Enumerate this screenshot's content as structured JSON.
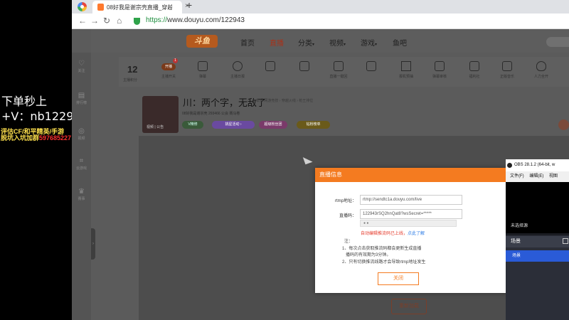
{
  "overlay": {
    "line1": "下单秒上",
    "line2": "+V：nb122943",
    "line3": "评估CF/和平精英/手游",
    "line4_text": "脱坑入坑加群",
    "line4_num": "597685227"
  },
  "browser": {
    "tab_title": "08好我是谢宗壳直播_穿越火线",
    "url_scheme": "https://",
    "url_rest": "www.douyu.com/122943"
  },
  "leftnav": {
    "items": [
      {
        "icon": "♡",
        "label": "关注"
      },
      {
        "icon": "▤",
        "label": "排行榜"
      },
      {
        "icon": "◎",
        "label": "视频"
      },
      {
        "icon": "⌗",
        "label": "云游戏"
      },
      {
        "icon": "♛",
        "label": "赛事"
      }
    ]
  },
  "header": {
    "logo": "斗鱼",
    "nav": [
      "首页",
      "直播",
      "分类",
      "视频",
      "游戏",
      "鱼吧"
    ]
  },
  "gifts": {
    "count": "12",
    "count_label": "主播积分",
    "kaibo": "开播",
    "badge": "1",
    "items": [
      "主播开关",
      "弹幕",
      "主播日报",
      "",
      "",
      "直播一键回",
      "",
      "报机预抽",
      "弹幕审核",
      "福利社",
      "正版音乐",
      "人力全开",
      ""
    ]
  },
  "room": {
    "title": "川：两个字，无敌了",
    "crumb": "举报   网游竞技 › 穿越火线 › 枪王排位",
    "meta": "08好我是谢宗壳   293466   公会  赛马卷",
    "thumb_label": "视频 | 公告",
    "tags": [
      "V精修",
      "挑星活动  ›",
      "超级粉丝团",
      "钻粉榜单"
    ]
  },
  "dialog": {
    "title": "直播信息",
    "rtmp_label": "rtmp地址：",
    "rtmp_value": "rtmp://sendtc1a.douyu.com/live",
    "key_label": "直播码：",
    "key_value": "122943rSQ2hnQat8?wsSecret=*****",
    "warn": "自动编辑推流码已上线，",
    "warn_link": "点此了解",
    "note_head": "注：",
    "note1": "1、每次点击获取推流码都会更新生成直播",
    "note1b": "播码的有效期为3分钟。",
    "note2": "2、只有切换推流线路才会导致rtmp地址发生",
    "close": "关闭"
  },
  "reload": "重新加载",
  "obs": {
    "title": "OBS 28.1.2 (64-bit, w",
    "menu": [
      "文件(F)",
      "编辑(E)",
      "视图"
    ],
    "no_scene": "未选择源",
    "scenes_header": "场景",
    "scene1": "场景"
  }
}
